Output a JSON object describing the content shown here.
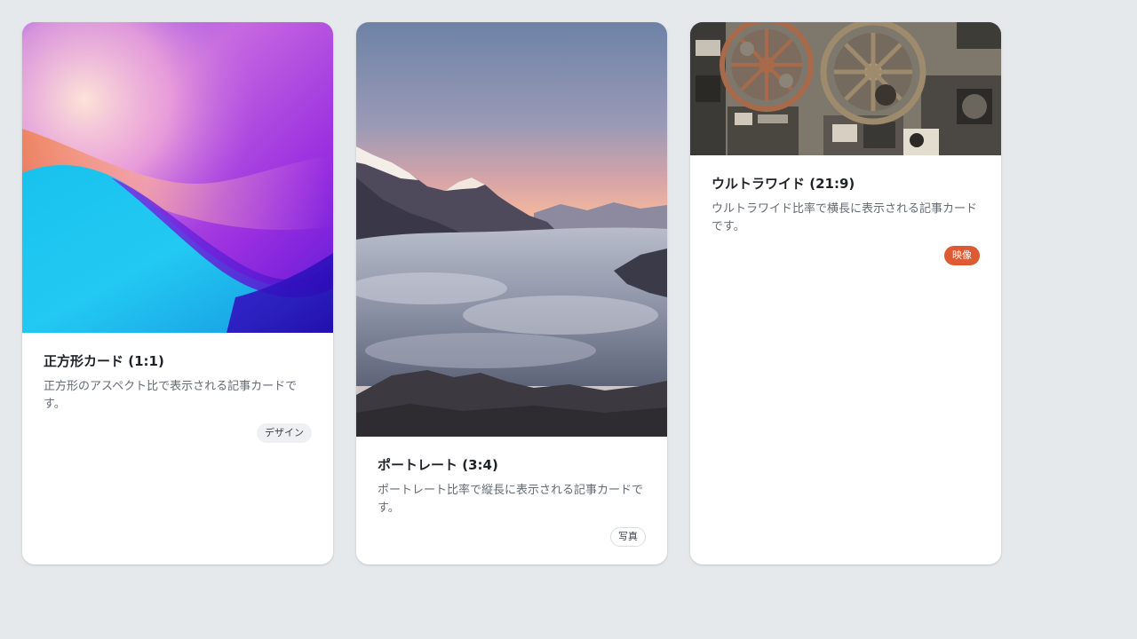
{
  "cards": [
    {
      "title": "正方形カード (1:1)",
      "description": "正方形のアスペクト比で表示される記事カードです。",
      "tag": "デザイン",
      "image": "abstract-gradient-waves",
      "tag_color": "#eef0f3"
    },
    {
      "title": "ポートレート (3:4)",
      "description": "ポートレート比率で縦長に表示される記事カードです。",
      "tag": "写真",
      "image": "mountains-above-clouds",
      "tag_color": "#ffffff"
    },
    {
      "title": "ウルトラワイド (21:9)",
      "description": "ウルトラワイド比率で横長に表示される記事カードです。",
      "tag": "映像",
      "image": "film-projector-reels",
      "tag_color": "#de5a33"
    }
  ]
}
